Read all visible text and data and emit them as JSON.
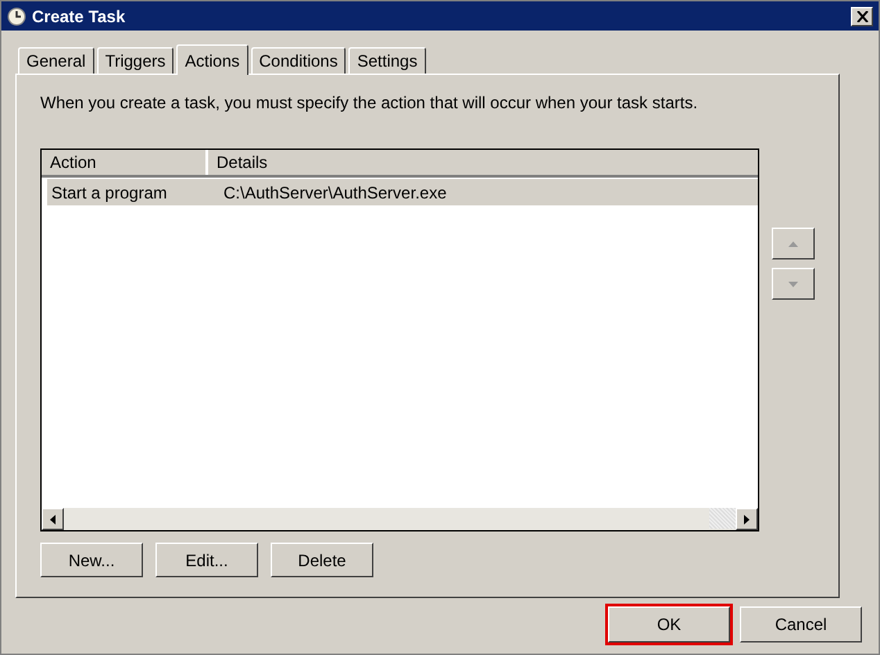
{
  "window": {
    "title": "Create Task"
  },
  "tabs": [
    {
      "label": "General",
      "selected": false
    },
    {
      "label": "Triggers",
      "selected": false
    },
    {
      "label": "Actions",
      "selected": true
    },
    {
      "label": "Conditions",
      "selected": false
    },
    {
      "label": "Settings",
      "selected": false
    }
  ],
  "description": "When you create a task, you must specify the action that will occur when your task starts.",
  "table": {
    "columns": [
      "Action",
      "Details"
    ],
    "rows": [
      {
        "cells": [
          "Start a program",
          "C:\\AuthServer\\AuthServer.exe"
        ],
        "selected": true
      }
    ]
  },
  "list_buttons": [
    "New...",
    "Edit...",
    "Delete"
  ],
  "dialog_buttons": [
    {
      "label": "OK",
      "highlighted": true
    },
    {
      "label": "Cancel",
      "highlighted": false
    }
  ]
}
